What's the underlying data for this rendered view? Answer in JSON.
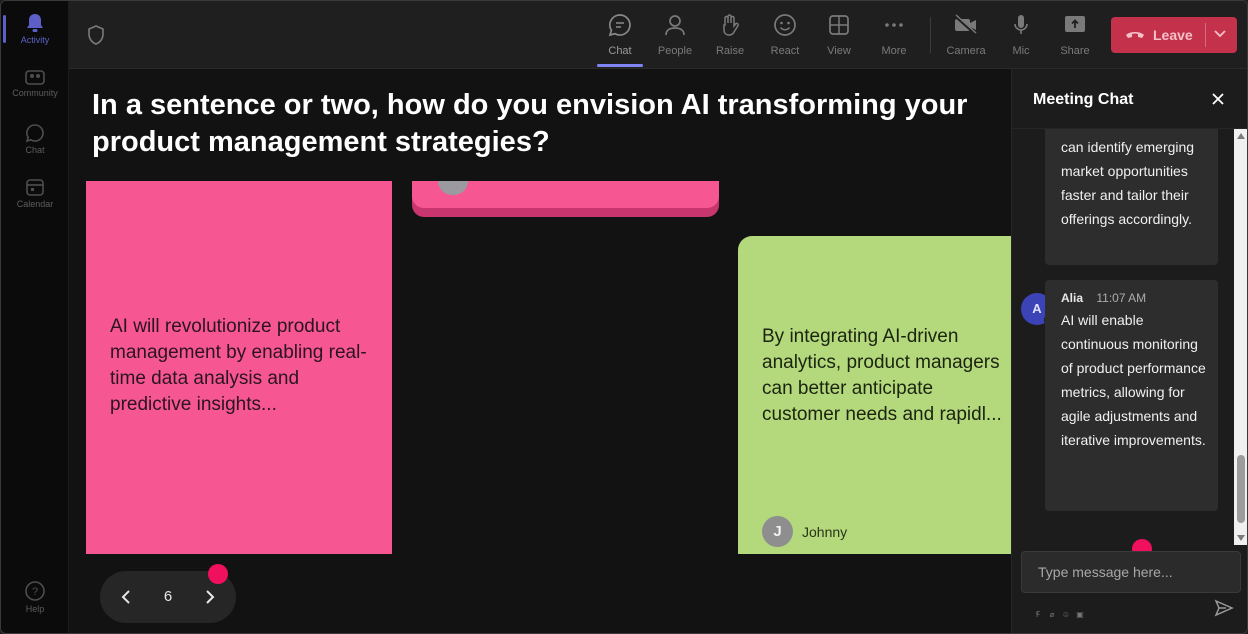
{
  "rail": {
    "items": [
      {
        "label": "Activity"
      },
      {
        "label": "Community"
      },
      {
        "label": "Chat"
      },
      {
        "label": "Calendar"
      }
    ],
    "help": {
      "label": "Help"
    }
  },
  "toolbar": {
    "chat": "Chat",
    "people": "People",
    "raise": "Raise",
    "react": "React",
    "view": "View",
    "more": "More",
    "camera": "Camera",
    "mic": "Mic",
    "share": "Share",
    "leave": "Leave"
  },
  "stage": {
    "question": "In a sentence or two, how do you envision AI transforming your product management strategies?",
    "notes": [
      {
        "text": "AI will revolutionize product management by enabling real-time data analysis and predictive insights...",
        "color": "#f65792"
      },
      {
        "color": "#f65792"
      },
      {
        "text": "By integrating AI-driven analytics, product managers can better anticipate customer needs and rapidl...",
        "author_initial": "J",
        "author": "Johnny",
        "color": "#b4d97c"
      }
    ],
    "pager": {
      "page": "6"
    }
  },
  "chat": {
    "title": "Meeting Chat",
    "messages": [
      {
        "text": "can identify emerging market opportunities faster and tailor their offerings accordingly."
      },
      {
        "initial": "A",
        "author": "Alia",
        "time": "11:07 AM",
        "text": "AI will enable continuous monitoring of product performance metrics, allowing for agile adjustments and iterative improvements."
      }
    ],
    "composer": {
      "placeholder": "Type message here..."
    }
  },
  "colors": {
    "accent": "#7f85f5",
    "leave": "#c4314b",
    "cursor_dot": "#f0105e"
  }
}
